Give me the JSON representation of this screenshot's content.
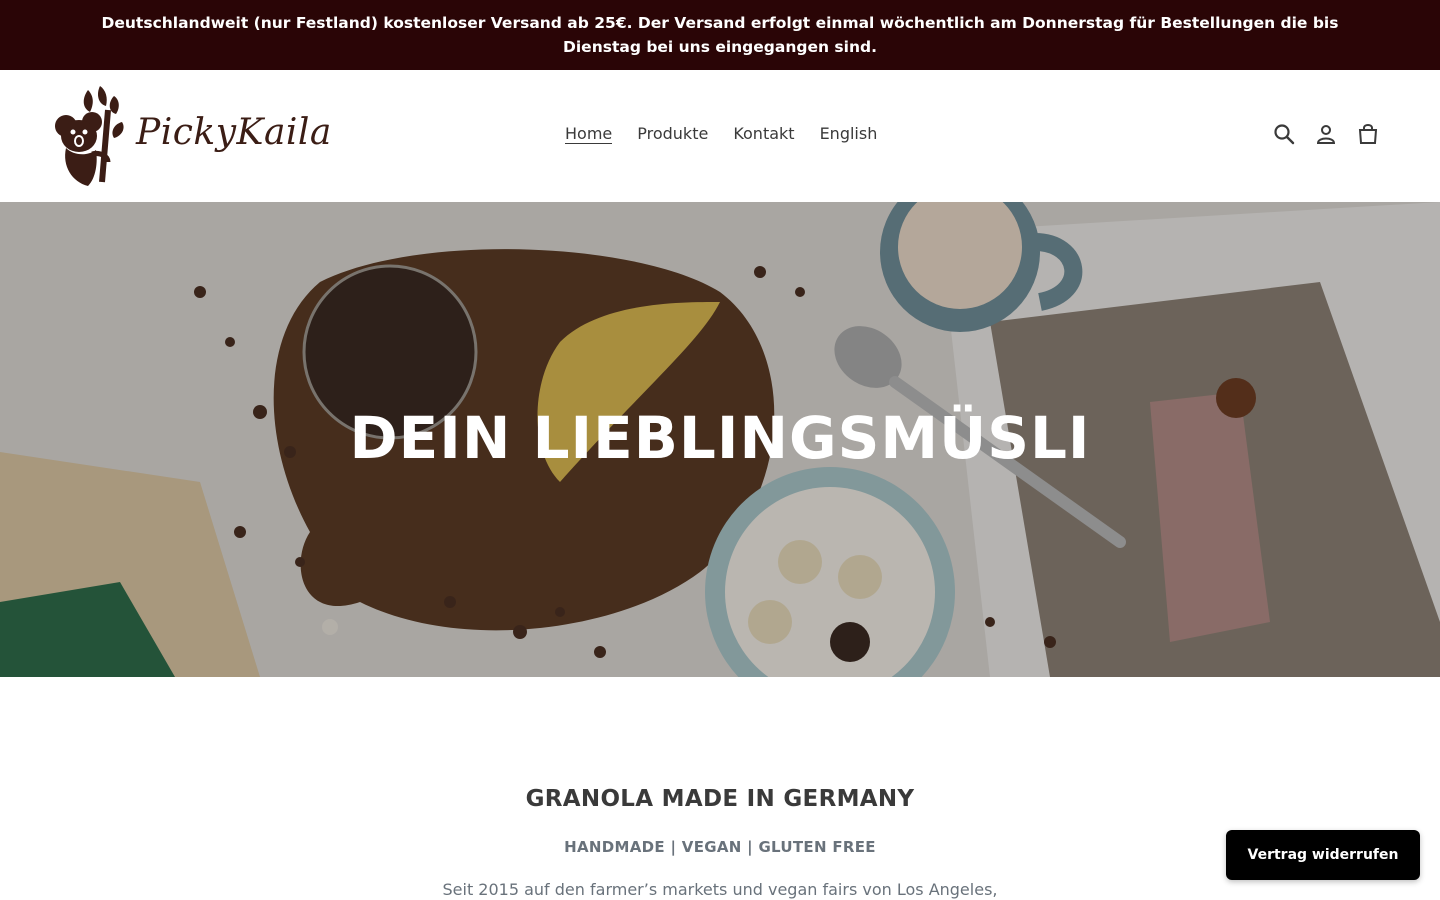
{
  "announcement": {
    "text": "Deutschlandweit (nur Festland) kostenloser Versand ab 25€. Der Versand erfolgt einmal wöchentlich am Donnerstag für Bestellungen die bis Dienstag bei uns eingegangen sind."
  },
  "header": {
    "logo_text": "PickyKaila",
    "nav": [
      {
        "label": "Home",
        "active": true
      },
      {
        "label": "Produkte",
        "active": false
      },
      {
        "label": "Kontakt",
        "active": false
      },
      {
        "label": "English",
        "active": false
      }
    ],
    "icons": [
      "search-icon",
      "account-icon",
      "cart-icon"
    ]
  },
  "hero": {
    "title": "DEIN LIEBLINGSMÜSLI"
  },
  "content": {
    "title": "GRANOLA MADE IN GERMANY",
    "subtitle": "HANDMADE | VEGAN | GLUTEN FREE",
    "intro": "Seit 2015 auf den farmer’s markets und vegan fairs von Los Angeles,"
  },
  "floating_button": {
    "label": "Vertrag widerrufen"
  },
  "colors": {
    "announcement_bg": "#2a0506",
    "logo_brown": "#3b1d15",
    "text_dark": "#3a3a3a",
    "text_muted": "#69727b",
    "button_bg": "#000000"
  }
}
